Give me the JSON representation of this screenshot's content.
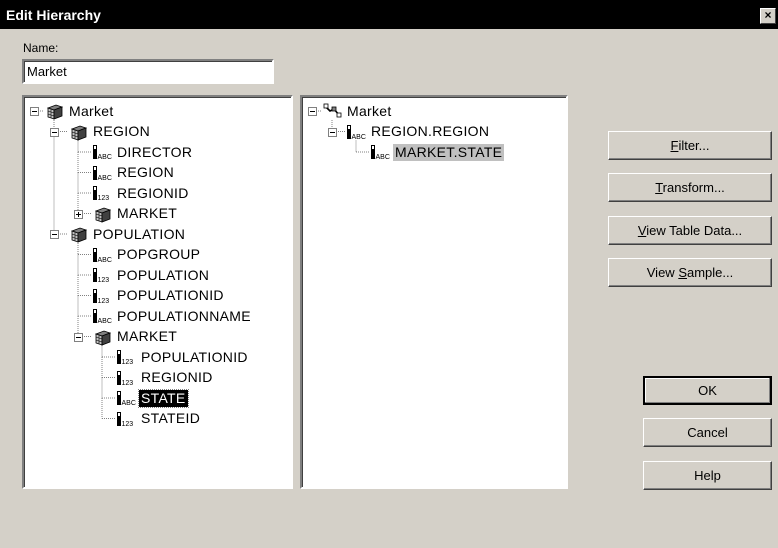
{
  "window": {
    "title": "Edit Hierarchy",
    "close_label": "×"
  },
  "name_field": {
    "label": "Name:",
    "value": "Market"
  },
  "left_tree": [
    {
      "label": "Market",
      "icon": "table-cube-icon",
      "level": 0,
      "expander": "minus"
    },
    {
      "label": "REGION",
      "icon": "table-cube-icon",
      "level": 1,
      "expander": "minus"
    },
    {
      "label": "DIRECTOR",
      "icon": "text-field-icon",
      "level": 2
    },
    {
      "label": "REGION",
      "icon": "text-field-icon",
      "level": 2
    },
    {
      "label": "REGIONID",
      "icon": "numeric-field-icon",
      "level": 2
    },
    {
      "label": "MARKET",
      "icon": "table-cube-icon",
      "level": 2,
      "expander": "plus"
    },
    {
      "label": "POPULATION",
      "icon": "table-cube-icon",
      "level": 1,
      "expander": "minus"
    },
    {
      "label": "POPGROUP",
      "icon": "text-field-icon",
      "level": 2
    },
    {
      "label": "POPULATION",
      "icon": "numeric-field-icon",
      "level": 2
    },
    {
      "label": "POPULATIONID",
      "icon": "numeric-field-icon",
      "level": 2
    },
    {
      "label": "POPULATIONNAME",
      "icon": "text-field-icon",
      "level": 2
    },
    {
      "label": "MARKET",
      "icon": "table-cube-icon",
      "level": 2,
      "expander": "minus"
    },
    {
      "label": "POPULATIONID",
      "icon": "numeric-field-icon",
      "level": 3
    },
    {
      "label": "REGIONID",
      "icon": "numeric-field-icon",
      "level": 3
    },
    {
      "label": "STATE",
      "icon": "text-field-icon",
      "level": 3,
      "selected": true
    },
    {
      "label": "STATEID",
      "icon": "numeric-field-icon",
      "level": 3
    }
  ],
  "right_tree": [
    {
      "label": "Market",
      "icon": "hierarchy-link-icon",
      "level": 0,
      "expander": "minus"
    },
    {
      "label": "REGION.REGION",
      "icon": "text-field-icon",
      "level": 1,
      "expander": "minus"
    },
    {
      "label": "MARKET.STATE",
      "icon": "text-field-icon",
      "level": 2,
      "highlighted": true
    }
  ],
  "buttons": {
    "filter": {
      "pre": "",
      "key": "F",
      "post": "ilter..."
    },
    "transform": {
      "pre": "",
      "key": "T",
      "post": "ransform..."
    },
    "view_table_data": {
      "pre": "",
      "key": "V",
      "post": "iew Table Data..."
    },
    "view_sample": {
      "pre": "View ",
      "key": "S",
      "post": "ample..."
    },
    "ok": "OK",
    "cancel": "Cancel",
    "help": "Help"
  }
}
